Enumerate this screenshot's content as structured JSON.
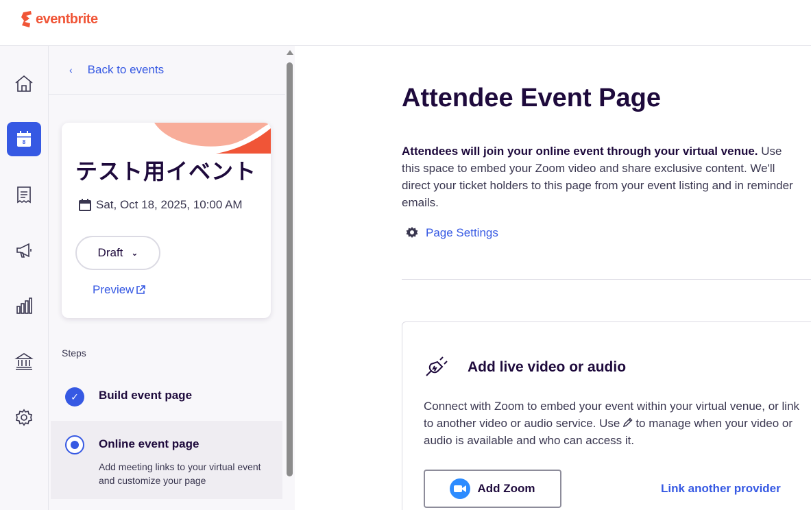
{
  "brand": {
    "name": "eventbrite",
    "color": "#f05537"
  },
  "rail": {
    "items": [
      {
        "icon": "home-icon"
      },
      {
        "icon": "calendar-icon",
        "badge": "8",
        "active": true
      },
      {
        "icon": "orders-icon"
      },
      {
        "icon": "megaphone-icon"
      },
      {
        "icon": "reports-icon"
      },
      {
        "icon": "finance-icon"
      },
      {
        "icon": "gear-icon"
      }
    ]
  },
  "panel": {
    "back_label": "Back to events",
    "event": {
      "title": "テスト用イベント",
      "date": "Sat, Oct 18, 2025, 10:00 AM",
      "status": "Draft",
      "preview_label": "Preview"
    },
    "steps_label": "Steps",
    "steps": [
      {
        "title": "Build event page",
        "state": "done"
      },
      {
        "title": "Online event page",
        "state": "current",
        "description": "Add meeting links to your virtual event and customize your page"
      }
    ]
  },
  "main": {
    "title": "Attendee Event Page",
    "intro_bold": "Attendees will join your online event through your virtual venue.",
    "intro_rest": " Use this space to embed your Zoom video and share exclusive content. We'll direct your ticket holders to this page from your event listing and in reminder emails.",
    "settings_label": "Page Settings",
    "video": {
      "title": "Add live video or audio",
      "desc_before": "Connect with Zoom to embed your event within your virtual venue, or link to another video or audio service. Use",
      "desc_after": "to manage when your video or audio is available and who can access it.",
      "zoom_label": "Add Zoom",
      "link_label": "Link another provider"
    }
  },
  "colors": {
    "accent": "#3659e3",
    "text": "#1e0a3c",
    "zoom": "#2d8cff"
  }
}
